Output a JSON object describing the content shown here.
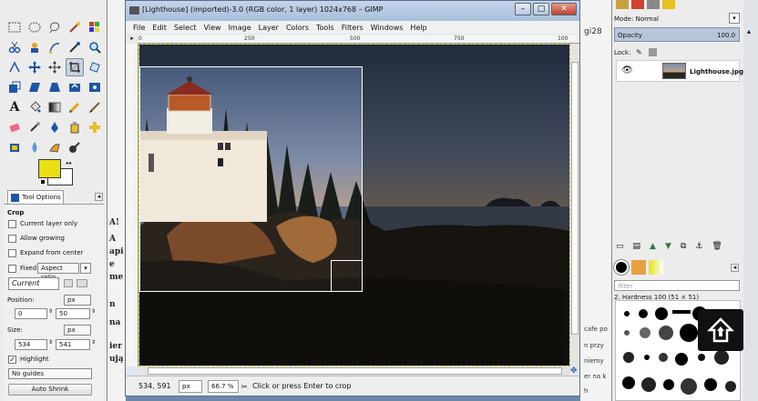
{
  "window": {
    "title": "[Lighthouse] (imported)-3.0 (RGB color, 1 layer) 1024x768 – GIMP",
    "controls": [
      "–",
      "□",
      "✕"
    ]
  },
  "menu": [
    "File",
    "Edit",
    "Select",
    "View",
    "Image",
    "Layer",
    "Colors",
    "Tools",
    "Filters",
    "Windows",
    "Help"
  ],
  "ruler": {
    "top_ticks": [
      "0",
      "250",
      "500",
      "750",
      "100"
    ]
  },
  "status": {
    "coords": "534, 591",
    "unit": "px",
    "zoom": "66.7 %",
    "message": "Click or press Enter to crop"
  },
  "tool_options": {
    "tab_label": "Tool Options",
    "tool_name": "Crop",
    "current_layer_only": "Current layer only",
    "allow_growing": "Allow growing",
    "expand_from_center": "Expand from center",
    "fixed_label": "Fixed:",
    "fixed_value": "Aspect ratio",
    "ratio_value": "Current",
    "position_label": "Position:",
    "position_unit": "px",
    "position_x": "0",
    "position_y": "50",
    "size_label": "Size:",
    "size_unit": "px",
    "size_w": "534",
    "size_h": "541",
    "highlight": "Highlight",
    "guides": "No guides",
    "auto_shrink": "Auto Shrink"
  },
  "layers": {
    "mode_label": "Mode: Normal",
    "opacity_label": "Opacity",
    "opacity_value": "100.0",
    "lock_label": "Lock:",
    "layer_name": "Lighthouse.jpg"
  },
  "brushes": {
    "filter_placeholder": "filter",
    "brush_name": "2. Hardness 100 (51 × 51)"
  },
  "background_fragments": {
    "left": [
      "A!",
      "A",
      "api",
      "e",
      "me",
      "n",
      "na",
      "ier",
      "ują"
    ],
    "right": [
      "gi28",
      "cafe po",
      "n przy",
      "niemy",
      "er na k",
      "h"
    ]
  },
  "colors": {
    "foreground": "#e8e010",
    "background": "#ffffff",
    "selection": "#ffffff"
  }
}
